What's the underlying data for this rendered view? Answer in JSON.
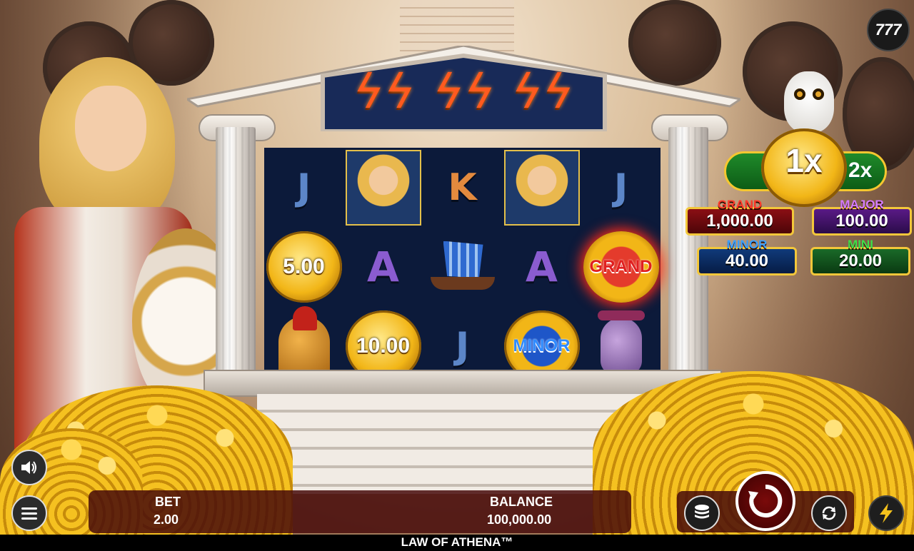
{
  "game": {
    "title": "LAW OF ATHENA™",
    "logo_text": "777"
  },
  "reels": [
    [
      "J",
      "athena",
      "K",
      "athena",
      "J"
    ],
    [
      "5.00",
      "A",
      "ship",
      "A",
      "GRAND"
    ],
    [
      "helmet",
      "10.00",
      "J",
      "MINOR",
      "vase"
    ]
  ],
  "symbols": {
    "r1c1": "J",
    "r1c3": "K",
    "r1c5": "J",
    "r2c1": "5.00",
    "r2c2": "A",
    "r2c4": "A",
    "r2c5": "GRAND",
    "r3c2": "10.00",
    "r3c3": "J",
    "r3c4": "MINOR"
  },
  "multiplier": {
    "current": "1x",
    "next": "2x"
  },
  "jackpots": {
    "grand": {
      "label": "GRAND",
      "amount": "1,000.00"
    },
    "major": {
      "label": "MAJOR",
      "amount": "100.00"
    },
    "minor": {
      "label": "MINOR",
      "amount": "40.00"
    },
    "mini": {
      "label": "MINI",
      "amount": "20.00"
    }
  },
  "bottom_bar": {
    "bet_label": "BET",
    "bet_value": "2.00",
    "balance_label": "BALANCE",
    "balance_value": "100,000.00"
  },
  "icons": {
    "sound": "speaker-icon",
    "menu": "hamburger-menu-icon",
    "bet": "coin-stack-icon",
    "spin": "spin-arrow-icon",
    "autoplay": "autoplay-icon",
    "turbo": "lightning-icon",
    "bolt": "lightning-bolt-icon"
  },
  "colors": {
    "grand": "#e01f1f",
    "major": "#d47cff",
    "minor": "#3aa0ff",
    "mini": "#3fe04a",
    "multiplier_bar": "#1f8a2a"
  }
}
